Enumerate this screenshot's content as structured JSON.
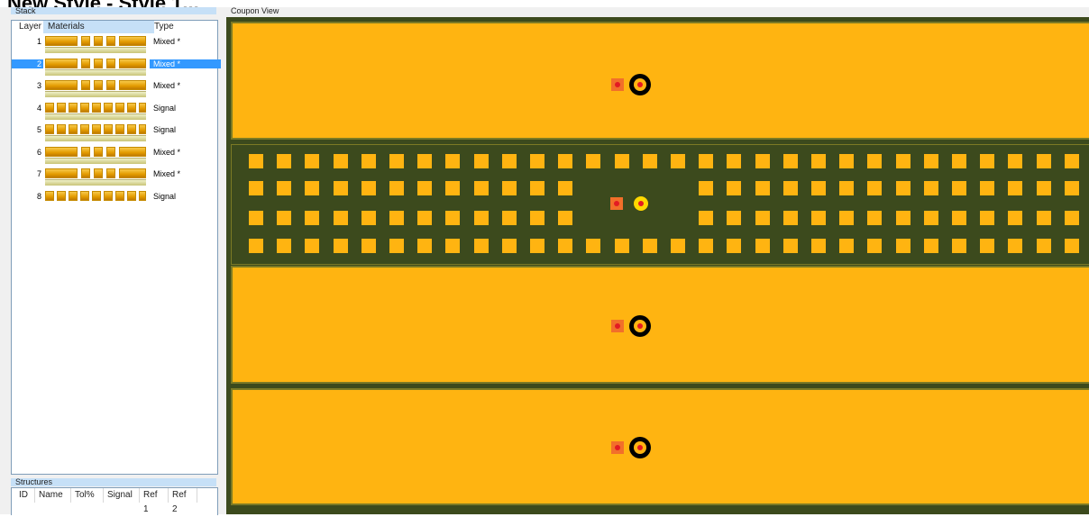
{
  "window": {
    "title": "New Style - Style 1..."
  },
  "stack_panel": {
    "title": "Stack",
    "columns": [
      "Layer",
      "Materials",
      "Type"
    ],
    "rows": [
      {
        "layer": "1",
        "type": "Mixed *",
        "pattern": "mixed"
      },
      {
        "layer": "2",
        "type": "Mixed *",
        "pattern": "mixed",
        "selected": true
      },
      {
        "layer": "3",
        "type": "Mixed *",
        "pattern": "mixed"
      },
      {
        "layer": "4",
        "type": "Signal",
        "pattern": "signal"
      },
      {
        "layer": "5",
        "type": "Signal",
        "pattern": "signal"
      },
      {
        "layer": "6",
        "type": "Mixed *",
        "pattern": "mixed"
      },
      {
        "layer": "7",
        "type": "Mixed *",
        "pattern": "mixed"
      },
      {
        "layer": "8",
        "type": "Signal",
        "pattern": "signal"
      }
    ]
  },
  "structures_panel": {
    "title": "Structures",
    "columns": [
      "ID",
      "Name",
      "Tol%",
      "Signal",
      "Ref 1",
      "Ref 2"
    ]
  },
  "coupon_view": {
    "title": "Coupon View",
    "colors": {
      "background": "#3c4a1d",
      "copper": "#ffb411",
      "pad": "#f26f2a",
      "drill": "#e31b23",
      "ring": "#000000",
      "signal_ring": "#ffd800"
    },
    "signal_rows": 4,
    "signal_columns": 30,
    "inner_rows_gap_columns": 4,
    "plane_count": 4
  }
}
